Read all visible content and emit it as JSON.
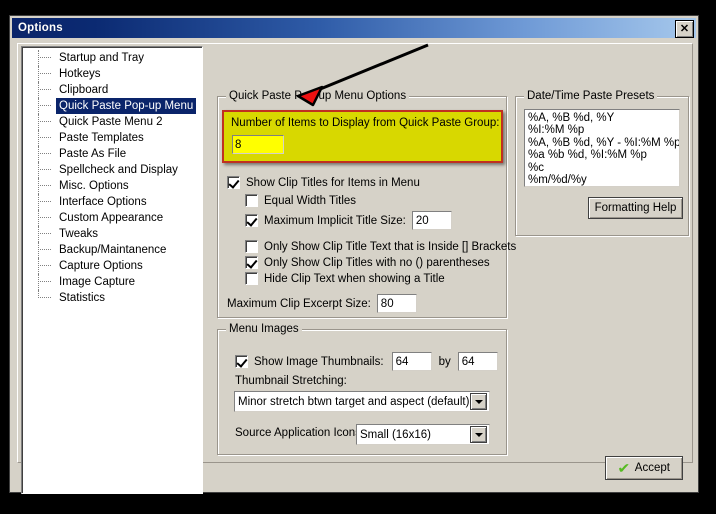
{
  "window": {
    "title": "Options",
    "close_label": "✕"
  },
  "tree": {
    "items": [
      {
        "label": "Startup and Tray",
        "selected": false
      },
      {
        "label": "Hotkeys",
        "selected": false
      },
      {
        "label": "Clipboard",
        "selected": false
      },
      {
        "label": "Quick Paste Pop-up Menu",
        "selected": true
      },
      {
        "label": "Quick Paste Menu 2",
        "selected": false
      },
      {
        "label": "Paste Templates",
        "selected": false
      },
      {
        "label": "Paste As File",
        "selected": false
      },
      {
        "label": "Spellcheck and Display",
        "selected": false
      },
      {
        "label": "Misc. Options",
        "selected": false
      },
      {
        "label": "Interface Options",
        "selected": false
      },
      {
        "label": "Custom Appearance",
        "selected": false
      },
      {
        "label": "Tweaks",
        "selected": false
      },
      {
        "label": "Backup/Maintanence",
        "selected": false
      },
      {
        "label": "Capture Options",
        "selected": false
      },
      {
        "label": "Image Capture",
        "selected": false
      },
      {
        "label": "Statistics",
        "selected": false
      }
    ]
  },
  "quick_paste_group": {
    "legend": "Quick Paste Pop-up Menu Options",
    "highlight": {
      "label": "Number of Items to Display from Quick Paste Group:",
      "value": "8",
      "border_color": "#c03020",
      "fill_color": "#d8d800",
      "input_fill": "#ffff00"
    },
    "show_clip_titles": {
      "label": "Show Clip Titles for Items in Menu",
      "checked": true
    },
    "equal_width_titles": {
      "label": "Equal Width Titles",
      "checked": false
    },
    "max_implicit_title": {
      "label": "Maximum Implicit Title Size:",
      "checked": true,
      "value": "20"
    },
    "only_brackets": {
      "label": "Only Show Clip Title Text that is Inside [] Brackets",
      "checked": false
    },
    "only_no_parens": {
      "label": "Only Show Clip Titles with no () parentheses",
      "checked": true
    },
    "hide_clip_text": {
      "label": "Hide Clip Text when showing a Title",
      "checked": false
    },
    "max_excerpt": {
      "label": "Maximum Clip Excerpt Size:",
      "value": "80"
    }
  },
  "menu_images_group": {
    "legend": "Menu Images",
    "show_thumbnails": {
      "label": "Show Image Thumbnails:",
      "checked": true,
      "width": "64",
      "by": "by",
      "height": "64"
    },
    "thumbnail_stretching": {
      "label": "Thumbnail Stretching:",
      "value": "Minor stretch btwn target and aspect (default)"
    },
    "source_app_icons": {
      "label": "Source Application Icons:",
      "value": "Small (16x16)"
    }
  },
  "datetime_group": {
    "legend": "Date/Time Paste Presets",
    "presets": [
      "%A, %B %d, %Y",
      "%I:%M %p",
      "%A, %B %d, %Y - %I:%M %p",
      "%a %b %d, %I:%M %p",
      "%c",
      "%m/%d/%y"
    ],
    "formatting_help_label": "Formatting Help"
  },
  "footer": {
    "accept_label": "Accept",
    "accept_icon": "✔"
  },
  "annotation": {
    "arrow_color": "#000000",
    "arrowhead_color": "#ee1111"
  }
}
